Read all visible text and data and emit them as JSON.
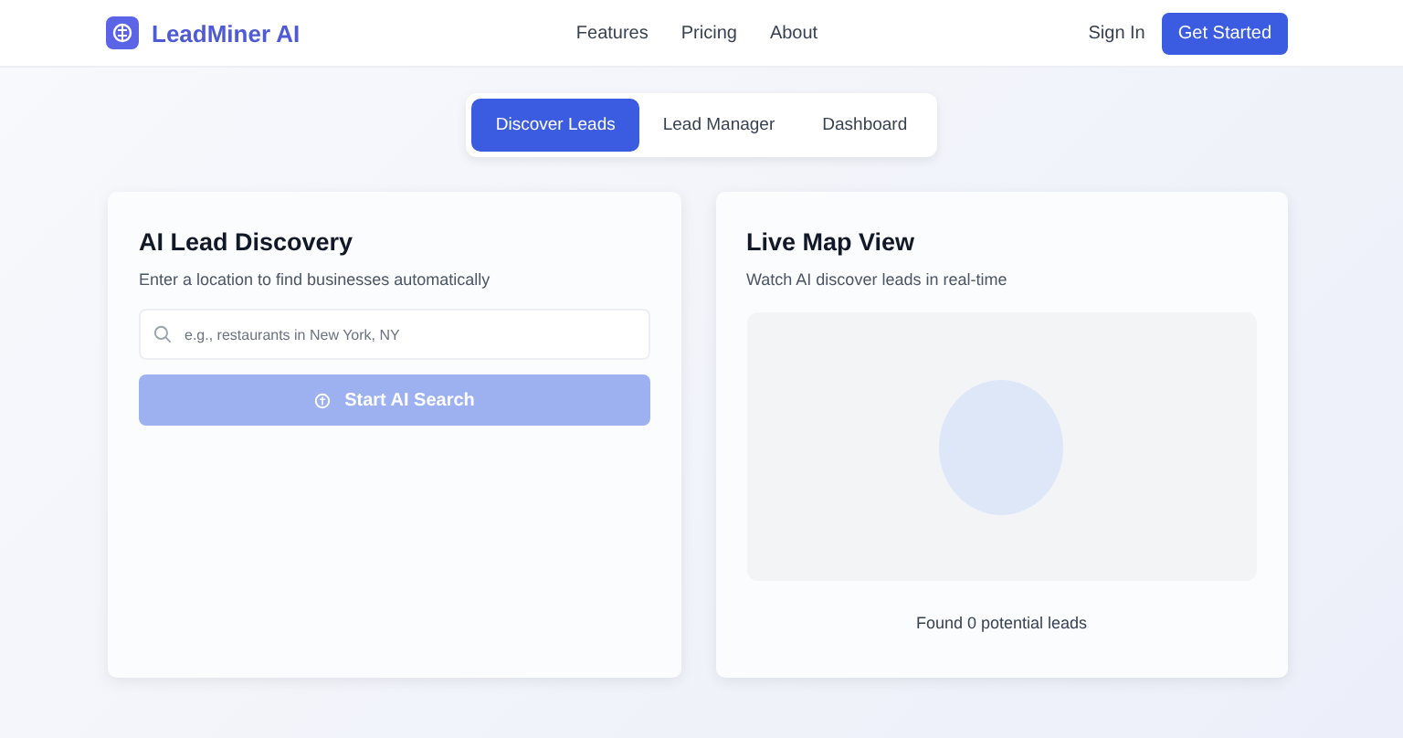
{
  "header": {
    "brand": "LeadMiner AI",
    "nav": [
      "Features",
      "Pricing",
      "About"
    ],
    "sign_in": "Sign In",
    "cta": "Get Started"
  },
  "tabs": [
    {
      "label": "Discover Leads",
      "selected": true
    },
    {
      "label": "Lead Manager",
      "selected": false
    },
    {
      "label": "Dashboard",
      "selected": false
    }
  ],
  "discovery": {
    "title": "AI Lead Discovery",
    "subtitle": "Enter a location to find businesses automatically",
    "search": {
      "placeholder": "e.g., restaurants in New York, NY"
    },
    "button": {
      "label": "Start AI Search",
      "disabled": true
    }
  },
  "map": {
    "title": "Live Map View",
    "subtitle": "Watch AI discover leads in real-time",
    "status": "Found 0 potential leads"
  }
}
